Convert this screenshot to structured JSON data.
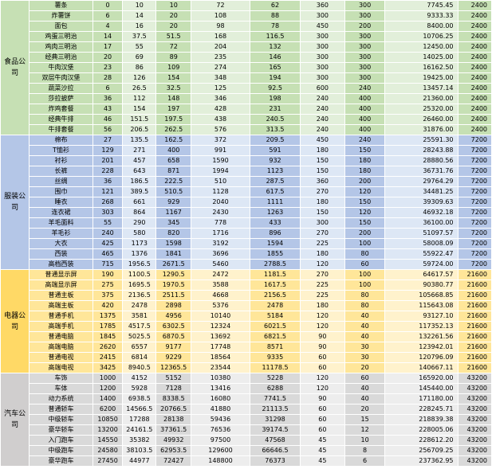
{
  "colors": {
    "food": {
      "light": "#e2efda",
      "mid": "#c6e0b4",
      "group": "#c6e0b4"
    },
    "clothing": {
      "light": "#dde7f5",
      "mid": "#b4c6e7",
      "group": "#b4c6e7"
    },
    "electronics": {
      "light": "#fff2cc",
      "mid": "#ffe699",
      "group": "#ffd966"
    },
    "auto": {
      "light": "#ededed",
      "mid": "#d9d9d9",
      "group": "#d0cece"
    }
  },
  "groups": [
    {
      "key": "food",
      "name": "食品公司",
      "rows": [
        [
          "薯条",
          "0",
          "10",
          "10",
          "72",
          "62",
          "360",
          "300",
          "7745.45",
          "2400"
        ],
        [
          "炸薯饼",
          "6",
          "14",
          "20",
          "108",
          "88",
          "300",
          "300",
          "9333.33",
          "2400"
        ],
        [
          "面包",
          "4",
          "16",
          "20",
          "98",
          "78",
          "450",
          "200",
          "8400.00",
          "2400"
        ],
        [
          "鸡蛋三明治",
          "14",
          "37.5",
          "51.5",
          "168",
          "116.5",
          "300",
          "300",
          "10706.25",
          "2400"
        ],
        [
          "鸡肉三明治",
          "17",
          "55",
          "72",
          "204",
          "132",
          "300",
          "300",
          "12450.00",
          "2400"
        ],
        [
          "经典三明治",
          "20",
          "69",
          "89",
          "235",
          "146",
          "300",
          "300",
          "14025.00",
          "2400"
        ],
        [
          "牛肉汉堡",
          "23",
          "86",
          "109",
          "274",
          "165",
          "300",
          "300",
          "16162.50",
          "2400"
        ],
        [
          "双层牛肉汉堡",
          "28",
          "126",
          "154",
          "348",
          "194",
          "300",
          "300",
          "19425.00",
          "2400"
        ],
        [
          "蔬菜沙拉",
          "6",
          "26.5",
          "32.5",
          "125",
          "92.5",
          "600",
          "240",
          "13457.14",
          "2400"
        ],
        [
          "莎拉披萨",
          "36",
          "112",
          "148",
          "346",
          "198",
          "240",
          "400",
          "21360.00",
          "2400"
        ],
        [
          "炸鸡套餐",
          "43",
          "154",
          "197",
          "428",
          "231",
          "240",
          "400",
          "25320.00",
          "2400"
        ],
        [
          "经典牛排",
          "46",
          "151.5",
          "197.5",
          "438",
          "240.5",
          "240",
          "400",
          "26460.00",
          "2400"
        ],
        [
          "牛排套餐",
          "56",
          "206.5",
          "262.5",
          "576",
          "313.5",
          "240",
          "400",
          "31876.00",
          "2400"
        ]
      ]
    },
    {
      "key": "clothing",
      "name": "服装公司",
      "rows": [
        [
          "棉布",
          "27",
          "135.5",
          "162.5",
          "372",
          "209.5",
          "450",
          "240",
          "25591.30",
          "7200"
        ],
        [
          "T恤衫",
          "129",
          "271",
          "400",
          "991",
          "591",
          "180",
          "150",
          "28243.88",
          "7200"
        ],
        [
          "衬衫",
          "201",
          "457",
          "658",
          "1590",
          "932",
          "150",
          "180",
          "28880.56",
          "7200"
        ],
        [
          "长裤",
          "228",
          "643",
          "871",
          "1994",
          "1123",
          "150",
          "180",
          "36731.76",
          "7200"
        ],
        [
          "丝绸",
          "36",
          "186.5",
          "222.5",
          "510",
          "287.5",
          "360",
          "200",
          "29764.29",
          "7200"
        ],
        [
          "围巾",
          "121",
          "389.5",
          "510.5",
          "1128",
          "617.5",
          "270",
          "120",
          "34481.25",
          "7200"
        ],
        [
          "睡衣",
          "268",
          "661",
          "929",
          "2040",
          "1111",
          "180",
          "150",
          "39309.63",
          "7200"
        ],
        [
          "连衣裙",
          "303",
          "864",
          "1167",
          "2430",
          "1263",
          "150",
          "120",
          "46932.18",
          "7200"
        ],
        [
          "羊毛面料",
          "55",
          "290",
          "345",
          "778",
          "433",
          "300",
          "150",
          "36100.00",
          "7200"
        ],
        [
          "羊毛衫",
          "240",
          "580",
          "820",
          "1716",
          "896",
          "270",
          "200",
          "51097.57",
          "7200"
        ],
        [
          "大衣",
          "425",
          "1173",
          "1598",
          "3192",
          "1594",
          "225",
          "100",
          "58008.09",
          "7200"
        ],
        [
          "西装",
          "465",
          "1376",
          "1841",
          "3696",
          "1855",
          "180",
          "80",
          "55922.47",
          "7200"
        ],
        [
          "高档西装",
          "715",
          "1956.5",
          "2671.5",
          "5460",
          "2788.5",
          "120",
          "60",
          "59724.00",
          "7200"
        ]
      ]
    },
    {
      "key": "electronics",
      "name": "电器公司",
      "rows": [
        [
          "普通显示屏",
          "190",
          "1100.5",
          "1290.5",
          "2472",
          "1181.5",
          "270",
          "100",
          "64617.57",
          "21600"
        ],
        [
          "高端显示屏",
          "275",
          "1695.5",
          "1970.5",
          "3588",
          "1617.5",
          "225",
          "100",
          "90380.77",
          "21600"
        ],
        [
          "普通主板",
          "375",
          "2136.5",
          "2511.5",
          "4668",
          "2156.5",
          "225",
          "80",
          "105668.85",
          "21600"
        ],
        [
          "高端主板",
          "420",
          "2478",
          "2898",
          "5376",
          "2478",
          "180",
          "80",
          "115643.08",
          "21600"
        ],
        [
          "普通手机",
          "1375",
          "3581",
          "4956",
          "10140",
          "5184",
          "120",
          "40",
          "93127.10",
          "21600"
        ],
        [
          "高端手机",
          "1785",
          "4517.5",
          "6302.5",
          "12324",
          "6021.5",
          "120",
          "40",
          "117352.13",
          "21600"
        ],
        [
          "普通电脑",
          "1845",
          "5025.5",
          "6870.5",
          "13692",
          "6821.5",
          "90",
          "40",
          "132261.56",
          "21600"
        ],
        [
          "高端电脑",
          "2620",
          "6557",
          "9177",
          "17748",
          "8571",
          "90",
          "30",
          "123942.01",
          "21600"
        ],
        [
          "普通电视",
          "2415",
          "6814",
          "9229",
          "18564",
          "9335",
          "60",
          "30",
          "120796.09",
          "21600"
        ],
        [
          "高端电视",
          "3425",
          "8940.5",
          "12365.5",
          "23544",
          "11178.5",
          "60",
          "20",
          "140667.11",
          "21600"
        ]
      ]
    },
    {
      "key": "auto",
      "name": "汽车公司",
      "rows": [
        [
          "车饰",
          "1000",
          "4152",
          "5152",
          "10380",
          "5228",
          "120",
          "60",
          "165920.00",
          "43200"
        ],
        [
          "车体",
          "1200",
          "5928",
          "7128",
          "13416",
          "6288",
          "120",
          "40",
          "145440.00",
          "43200"
        ],
        [
          "动力系统",
          "1400",
          "6938.5",
          "8338.5",
          "16080",
          "7741.5",
          "90",
          "40",
          "171180.00",
          "43200"
        ],
        [
          "普通轿车",
          "6200",
          "14566.5",
          "20766.5",
          "41880",
          "21113.5",
          "60",
          "20",
          "228245.71",
          "43200"
        ],
        [
          "中级轿车",
          "10850",
          "17288",
          "28138",
          "59436",
          "31298",
          "60",
          "15",
          "218839.38",
          "43200"
        ],
        [
          "豪华轿车",
          "13200",
          "24161.5",
          "37361.5",
          "76536",
          "39174.5",
          "60",
          "12",
          "228005.06",
          "43200"
        ],
        [
          "入门跑车",
          "14550",
          "35382",
          "49932",
          "97500",
          "47568",
          "45",
          "10",
          "228612.20",
          "43200"
        ],
        [
          "中级跑车",
          "24580",
          "38103.5",
          "62953.5",
          "129600",
          "66646.5",
          "45",
          "8",
          "256709.25",
          "43200"
        ],
        [
          "豪华跑车",
          "27450",
          "44977",
          "72427",
          "148800",
          "76373",
          "45",
          "6",
          "237362.95",
          "43200"
        ]
      ]
    }
  ]
}
